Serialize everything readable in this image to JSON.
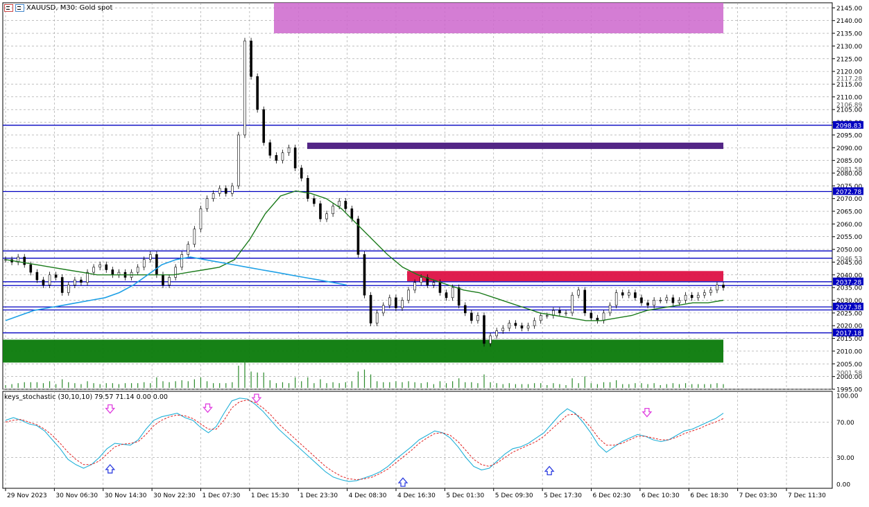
{
  "header": {
    "symbol_text": "XAUUSD, M30:  Gold spot",
    "icon_left": "calendar-icon",
    "icon_right": "chart-icon"
  },
  "indicator": {
    "label": "keys_stochastic (30,10,10) 79.57 71.14 0.00 0.00"
  },
  "colors": {
    "grid": "#9a9a9a",
    "up_candle": "#000000",
    "sma_green": "#1a7a1a",
    "sma_blue": "#1ea0e6",
    "zigzag_red": "#e01010",
    "zigzag_blue": "#1e90ff",
    "zone_magenta": "#cc66cc",
    "zone_purple": "#4a1a80",
    "zone_green": "#0a7a0a",
    "zone_red": "#dd1144",
    "hline_blue": "#0000c0",
    "stoch_main": "#20b0d8",
    "stoch_signal": "#e02020",
    "arrow_down": "#e040e0",
    "arrow_up": "#3040e0"
  },
  "price_axis": {
    "labels": [
      "2145.00",
      "2140.00",
      "2135.00",
      "2130.00",
      "2125.00",
      "2120.00",
      "2115.00",
      "2110.00",
      "2105.00",
      "2100.00",
      "2095.00",
      "2090.00",
      "2085.00",
      "2080.00",
      "2075.00",
      "2070.00",
      "2065.00",
      "2060.00",
      "2055.00",
      "2050.00",
      "2045.00",
      "2040.00",
      "2035.00",
      "2030.00",
      "2025.00",
      "2020.00",
      "2015.00",
      "2010.00",
      "2005.00",
      "2000.00",
      "1995.00"
    ],
    "highlight_labels": [
      {
        "text": "2098.83",
        "price": 2098.83
      },
      {
        "text": "2037.28",
        "price": 2037.28
      },
      {
        "text": "2027.38",
        "price": 2027.38
      },
      {
        "text": "2017.18",
        "price": 2017.18
      },
      {
        "text": "2072.78",
        "price": 2072.78
      }
    ],
    "faint_labels": [
      {
        "text": "2117.28",
        "price": 2117.28
      },
      {
        "text": "2106.89",
        "price": 2106.89
      },
      {
        "text": "2081.58",
        "price": 2081.58
      },
      {
        "text": "2046.53",
        "price": 2046.53
      },
      {
        "text": "2001.58",
        "price": 2001.58
      }
    ]
  },
  "time_axis": {
    "labels": [
      "29 Nov 2023",
      "30 Nov 06:30",
      "30 Nov 14:30",
      "30 Nov 22:30",
      "1 Dec 07:30",
      "1 Dec 15:30",
      "1 Dec 23:30",
      "4 Dec 08:30",
      "4 Dec 16:30",
      "5 Dec 01:30",
      "5 Dec 09:30",
      "5 Dec 17:30",
      "6 Dec 02:30",
      "6 Dec 10:30",
      "6 Dec 18:30",
      "7 Dec 03:30",
      "7 Dec 11:30"
    ]
  },
  "stoch_axis": {
    "labels": [
      "100.00",
      "70.00",
      "30.00",
      "0.00"
    ],
    "levels": [
      100,
      70,
      30,
      0
    ]
  },
  "chart_data": [
    {
      "type": "line",
      "panel": "price",
      "title": "",
      "ylim": [
        1995,
        2147
      ],
      "close_series": [
        2046,
        2045,
        2047,
        2044,
        2041,
        2038,
        2036,
        2040,
        2039,
        2033,
        2036,
        2038,
        2037,
        2041,
        2043,
        2044,
        2042,
        2040,
        2041,
        2039,
        2041,
        2043,
        2046,
        2048,
        2040,
        2036,
        2039,
        2043,
        2048,
        2052,
        2058,
        2066,
        2070,
        2072,
        2074,
        2072,
        2075,
        2095,
        2132,
        2118,
        2105,
        2092,
        2087,
        2085,
        2088,
        2090,
        2082,
        2078,
        2070,
        2068,
        2062,
        2064,
        2067,
        2069,
        2066,
        2062,
        2048,
        2032,
        2021,
        2025,
        2028,
        2031,
        2027,
        2030,
        2034,
        2037,
        2039,
        2036,
        2037,
        2033,
        2031,
        2035,
        2028,
        2025,
        2022,
        2024,
        2013,
        2016,
        2018,
        2019,
        2021,
        2020,
        2019,
        2020,
        2022,
        2024,
        2024,
        2026,
        2025,
        2025,
        2032,
        2034,
        2025,
        2023,
        2022,
        2025,
        2028,
        2033,
        2032,
        2033,
        2031,
        2029,
        2028,
        2030,
        2030,
        2031,
        2029,
        2030,
        2032,
        2031,
        2032,
        2033,
        2034,
        2036,
        2035
      ],
      "sma_green": [
        2046,
        2045,
        2044,
        2043,
        2042,
        2041,
        2040,
        2040,
        2040,
        2040,
        2040,
        2040,
        2041,
        2042,
        2043,
        2046,
        2054,
        2064,
        2071,
        2073,
        2072,
        2070,
        2066,
        2060,
        2054,
        2048,
        2043,
        2040,
        2038,
        2036,
        2034,
        2033,
        2031,
        2029,
        2027,
        2025,
        2024,
        2023,
        2022,
        2022,
        2023,
        2024,
        2026,
        2027,
        2028,
        2029,
        2029,
        2030
      ],
      "sma_blue": [
        2022,
        2024,
        2026,
        2027,
        2028,
        2029,
        2030,
        2031,
        2033,
        2036,
        2040,
        2044,
        2046,
        2047,
        2046,
        2045,
        2044,
        2043,
        2042,
        2041,
        2040,
        2039,
        2038,
        2037,
        2036
      ],
      "horizontal_levels": [
        2098.83,
        2072.78,
        2049.4,
        2046.53,
        2037.28,
        2035.8,
        2027.38,
        2026.2,
        2017.18
      ],
      "zones": [
        {
          "name": "supply-zone-top",
          "from": 2135,
          "to": 2147,
          "color": "#cc66cc"
        },
        {
          "name": "supply-zone-purple",
          "from": 2089.5,
          "to": 2092,
          "color": "#4a1a80"
        },
        {
          "name": "demand-zone-green",
          "from": 2005.5,
          "to": 2014.5,
          "color": "#0a7a0a"
        },
        {
          "name": "supply-zone-red",
          "from": 2037.5,
          "to": 2041.5,
          "color": "#dd1144"
        }
      ]
    },
    {
      "type": "line",
      "panel": "stochastic",
      "title": "",
      "ylim": [
        0,
        100
      ],
      "series": [
        {
          "values": [
            72,
            75,
            72,
            68,
            66,
            60,
            50,
            40,
            28,
            22,
            18,
            22,
            30,
            40,
            46,
            45,
            44,
            50,
            62,
            72,
            76,
            78,
            80,
            75,
            72,
            64,
            58,
            65,
            80,
            94,
            97,
            96,
            90,
            82,
            72,
            62,
            54,
            46,
            38,
            30,
            22,
            14,
            8,
            5,
            3,
            4,
            7,
            10,
            14,
            20,
            28,
            35,
            42,
            50,
            55,
            60,
            58,
            52,
            42,
            30,
            20,
            16,
            18,
            26,
            34,
            40,
            42,
            46,
            52,
            58,
            68,
            78,
            85,
            80,
            70,
            58,
            44,
            36,
            42,
            48,
            52,
            56,
            54,
            50,
            48,
            50,
            55,
            60,
            62,
            66,
            70,
            74,
            80
          ]
        },
        {
          "values": [
            70,
            72,
            73,
            70,
            67,
            62,
            55,
            46,
            36,
            28,
            22,
            22,
            26,
            34,
            42,
            45,
            46,
            48,
            56,
            66,
            72,
            76,
            78,
            77,
            74,
            68,
            62,
            62,
            72,
            86,
            93,
            95,
            92,
            86,
            78,
            68,
            60,
            52,
            44,
            36,
            28,
            20,
            14,
            9,
            6,
            5,
            6,
            8,
            12,
            17,
            24,
            31,
            38,
            46,
            52,
            57,
            58,
            55,
            48,
            38,
            28,
            22,
            20,
            24,
            30,
            36,
            40,
            44,
            48,
            54,
            62,
            70,
            78,
            79,
            74,
            64,
            52,
            44,
            44,
            46,
            50,
            54,
            54,
            52,
            50,
            50,
            53,
            57,
            60,
            63,
            67,
            70,
            74
          ]
        }
      ],
      "arrows": [
        {
          "kind": "down",
          "time_label": "30 Nov 14:30",
          "value": 84
        },
        {
          "kind": "down",
          "time_label": "1 Dec 07:30",
          "value": 85
        },
        {
          "kind": "down",
          "time_label": "1 Dec 15:30",
          "value": 96
        },
        {
          "kind": "down",
          "time_label": "6 Dec 10:30",
          "value": 80
        },
        {
          "kind": "up",
          "time_label": "30 Nov 14:30",
          "value": 18
        },
        {
          "kind": "up",
          "time_label": "4 Dec 16:30",
          "value": 3
        },
        {
          "kind": "up",
          "time_label": "5 Dec 17:30",
          "value": 16
        }
      ]
    }
  ]
}
